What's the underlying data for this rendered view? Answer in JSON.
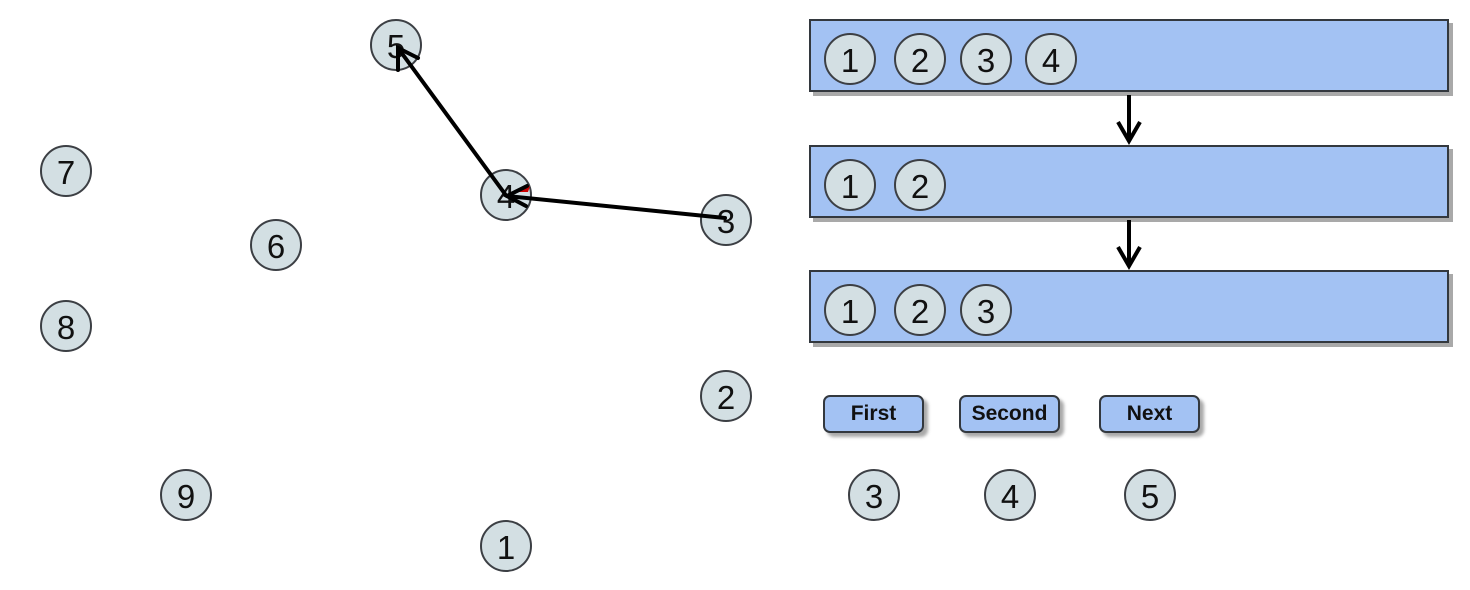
{
  "scene": {
    "free_nodes": [
      {
        "id": "1",
        "label": "1"
      },
      {
        "id": "2",
        "label": "2"
      },
      {
        "id": "3",
        "label": "3"
      },
      {
        "id": "4",
        "label": "4"
      },
      {
        "id": "5",
        "label": "5"
      },
      {
        "id": "6",
        "label": "6"
      },
      {
        "id": "7",
        "label": "7"
      },
      {
        "id": "8",
        "label": "8"
      },
      {
        "id": "9",
        "label": "9"
      }
    ],
    "edges": [
      {
        "from": "3",
        "to": "4",
        "directed": true
      },
      {
        "from": "4",
        "to": "5",
        "directed": true
      }
    ],
    "highlight_marker": {
      "near_node": "4",
      "color": "#cc0000"
    }
  },
  "pipeline": {
    "panels": [
      {
        "name": "panel-1",
        "nodes": [
          "1",
          "2",
          "3",
          "4"
        ]
      },
      {
        "name": "panel-2",
        "nodes": [
          "1",
          "2"
        ]
      },
      {
        "name": "panel-3",
        "nodes": [
          "1",
          "2",
          "3"
        ]
      }
    ],
    "connectors": [
      {
        "from": "panel-1",
        "to": "panel-2",
        "icon": "arrow-down-icon"
      },
      {
        "from": "panel-2",
        "to": "panel-3",
        "icon": "arrow-down-icon"
      }
    ]
  },
  "controls": {
    "buttons": [
      {
        "label": "First"
      },
      {
        "label": "Second"
      },
      {
        "label": "Next"
      }
    ],
    "button_nodes": [
      {
        "label": "3"
      },
      {
        "label": "4"
      },
      {
        "label": "5"
      }
    ]
  },
  "colors": {
    "node_fill": "#d3dfe3",
    "node_stroke": "#3c3f44",
    "panel_fill": "#a3c2f3",
    "panel_stroke": "#33383e",
    "shadow": "#a9a9a9",
    "edge": "#000000",
    "marker": "#cc0000"
  }
}
